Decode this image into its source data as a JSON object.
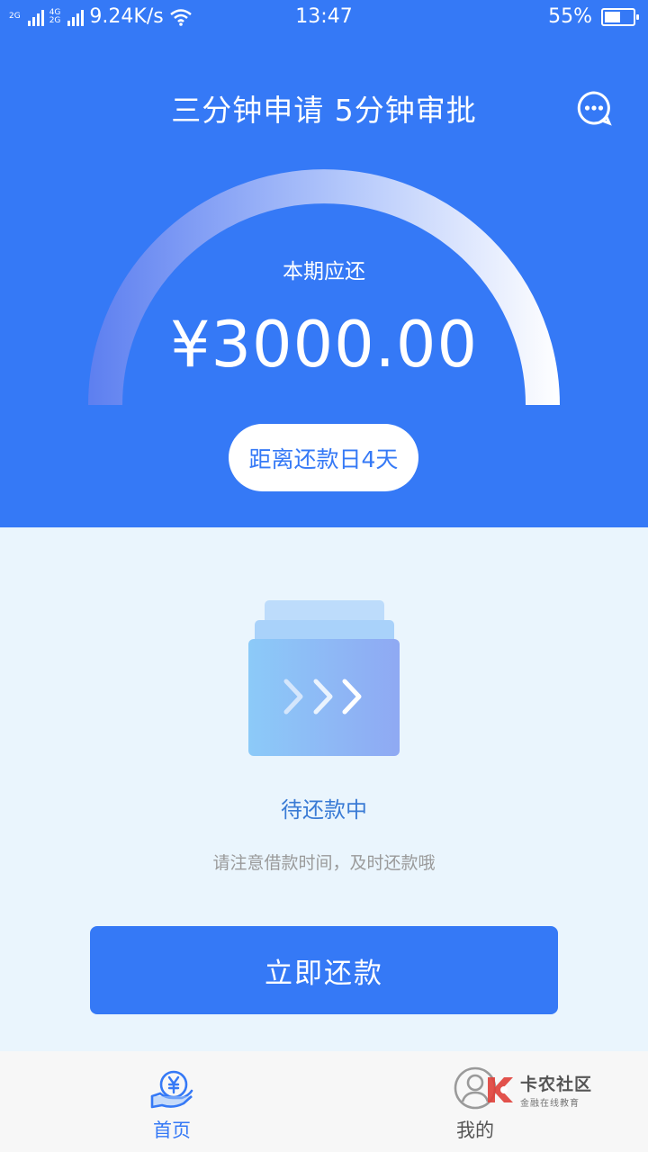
{
  "status_bar": {
    "net_top": "2G",
    "net_mid_top": "4G",
    "net_mid_bottom": "2G",
    "speed": "9.24K/s",
    "time": "13:47",
    "battery": "55%",
    "battery_level": 0.55
  },
  "header": {
    "title": "三分钟申请 5分钟审批",
    "chat_icon": "chat-bubble-icon"
  },
  "repayment": {
    "label": "本期应还",
    "amount": "¥3000.00",
    "days_left": "距离还款日4天"
  },
  "status": {
    "text": "待还款中",
    "hint": "请注意借款时间，及时还款哦"
  },
  "actions": {
    "repay_label": "立即还款"
  },
  "tabbar": {
    "items": [
      {
        "label": "首页",
        "icon": "yen-hand-icon",
        "active": true
      },
      {
        "label": "我的",
        "icon": "user-icon",
        "active": false
      }
    ]
  },
  "watermark": {
    "title": "卡农社区",
    "subtitle": "金融在线教育"
  },
  "colors": {
    "primary": "#3579f6",
    "background": "#eaf5fd",
    "tabbar": "#f7f7f7"
  }
}
